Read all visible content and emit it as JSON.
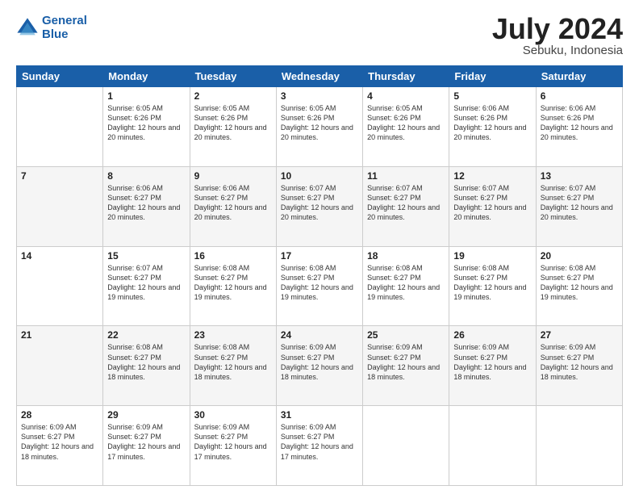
{
  "logo": {
    "line1": "General",
    "line2": "Blue"
  },
  "title": "July 2024",
  "subtitle": "Sebuku, Indonesia",
  "days_of_week": [
    "Sunday",
    "Monday",
    "Tuesday",
    "Wednesday",
    "Thursday",
    "Friday",
    "Saturday"
  ],
  "weeks": [
    [
      {
        "day": "",
        "info": ""
      },
      {
        "day": "1",
        "info": "Sunrise: 6:05 AM\nSunset: 6:26 PM\nDaylight: 12 hours and 20 minutes."
      },
      {
        "day": "2",
        "info": "Sunrise: 6:05 AM\nSunset: 6:26 PM\nDaylight: 12 hours and 20 minutes."
      },
      {
        "day": "3",
        "info": "Sunrise: 6:05 AM\nSunset: 6:26 PM\nDaylight: 12 hours and 20 minutes."
      },
      {
        "day": "4",
        "info": "Sunrise: 6:05 AM\nSunset: 6:26 PM\nDaylight: 12 hours and 20 minutes."
      },
      {
        "day": "5",
        "info": "Sunrise: 6:06 AM\nSunset: 6:26 PM\nDaylight: 12 hours and 20 minutes."
      },
      {
        "day": "6",
        "info": "Sunrise: 6:06 AM\nSunset: 6:26 PM\nDaylight: 12 hours and 20 minutes."
      }
    ],
    [
      {
        "day": "7",
        "info": ""
      },
      {
        "day": "8",
        "info": "Sunrise: 6:06 AM\nSunset: 6:27 PM\nDaylight: 12 hours and 20 minutes."
      },
      {
        "day": "9",
        "info": "Sunrise: 6:06 AM\nSunset: 6:27 PM\nDaylight: 12 hours and 20 minutes."
      },
      {
        "day": "10",
        "info": "Sunrise: 6:07 AM\nSunset: 6:27 PM\nDaylight: 12 hours and 20 minutes."
      },
      {
        "day": "11",
        "info": "Sunrise: 6:07 AM\nSunset: 6:27 PM\nDaylight: 12 hours and 20 minutes."
      },
      {
        "day": "12",
        "info": "Sunrise: 6:07 AM\nSunset: 6:27 PM\nDaylight: 12 hours and 20 minutes."
      },
      {
        "day": "13",
        "info": "Sunrise: 6:07 AM\nSunset: 6:27 PM\nDaylight: 12 hours and 20 minutes."
      }
    ],
    [
      {
        "day": "14",
        "info": ""
      },
      {
        "day": "15",
        "info": "Sunrise: 6:07 AM\nSunset: 6:27 PM\nDaylight: 12 hours and 19 minutes."
      },
      {
        "day": "16",
        "info": "Sunrise: 6:08 AM\nSunset: 6:27 PM\nDaylight: 12 hours and 19 minutes."
      },
      {
        "day": "17",
        "info": "Sunrise: 6:08 AM\nSunset: 6:27 PM\nDaylight: 12 hours and 19 minutes."
      },
      {
        "day": "18",
        "info": "Sunrise: 6:08 AM\nSunset: 6:27 PM\nDaylight: 12 hours and 19 minutes."
      },
      {
        "day": "19",
        "info": "Sunrise: 6:08 AM\nSunset: 6:27 PM\nDaylight: 12 hours and 19 minutes."
      },
      {
        "day": "20",
        "info": "Sunrise: 6:08 AM\nSunset: 6:27 PM\nDaylight: 12 hours and 19 minutes."
      }
    ],
    [
      {
        "day": "21",
        "info": ""
      },
      {
        "day": "22",
        "info": "Sunrise: 6:08 AM\nSunset: 6:27 PM\nDaylight: 12 hours and 18 minutes."
      },
      {
        "day": "23",
        "info": "Sunrise: 6:08 AM\nSunset: 6:27 PM\nDaylight: 12 hours and 18 minutes."
      },
      {
        "day": "24",
        "info": "Sunrise: 6:09 AM\nSunset: 6:27 PM\nDaylight: 12 hours and 18 minutes."
      },
      {
        "day": "25",
        "info": "Sunrise: 6:09 AM\nSunset: 6:27 PM\nDaylight: 12 hours and 18 minutes."
      },
      {
        "day": "26",
        "info": "Sunrise: 6:09 AM\nSunset: 6:27 PM\nDaylight: 12 hours and 18 minutes."
      },
      {
        "day": "27",
        "info": "Sunrise: 6:09 AM\nSunset: 6:27 PM\nDaylight: 12 hours and 18 minutes."
      }
    ],
    [
      {
        "day": "28",
        "info": "Sunrise: 6:09 AM\nSunset: 6:27 PM\nDaylight: 12 hours and 18 minutes."
      },
      {
        "day": "29",
        "info": "Sunrise: 6:09 AM\nSunset: 6:27 PM\nDaylight: 12 hours and 17 minutes."
      },
      {
        "day": "30",
        "info": "Sunrise: 6:09 AM\nSunset: 6:27 PM\nDaylight: 12 hours and 17 minutes."
      },
      {
        "day": "31",
        "info": "Sunrise: 6:09 AM\nSunset: 6:27 PM\nDaylight: 12 hours and 17 minutes."
      },
      {
        "day": "",
        "info": ""
      },
      {
        "day": "",
        "info": ""
      },
      {
        "day": "",
        "info": ""
      }
    ]
  ],
  "row_shading": [
    false,
    true,
    false,
    true,
    false
  ]
}
